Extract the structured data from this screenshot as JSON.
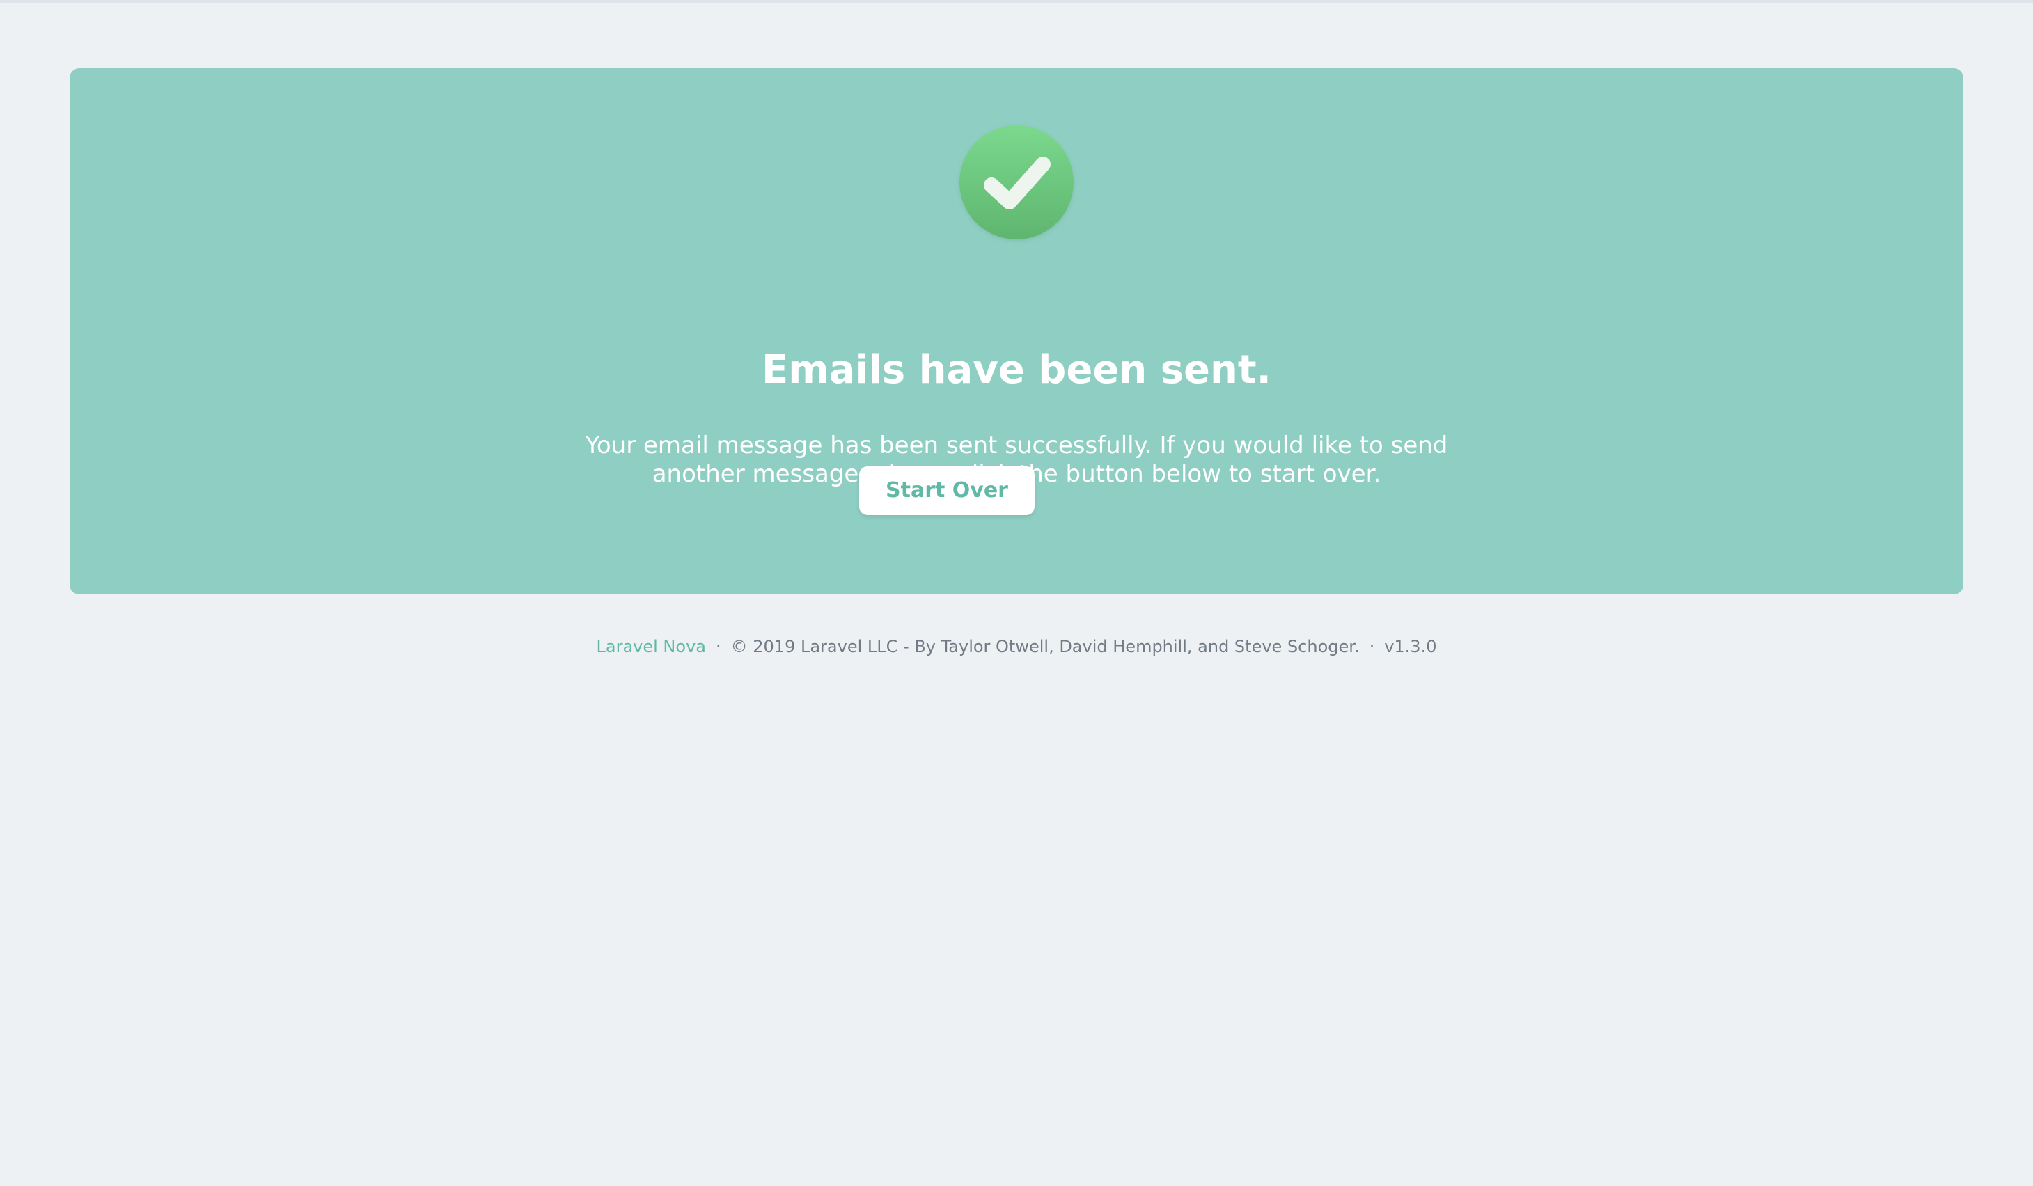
{
  "colors": {
    "page_background": "#eef1f4",
    "card_background": "#8fcfc3",
    "accent": "#5fb9a6",
    "success_badge_top": "#7bd98e",
    "success_badge_bottom": "#5fb56f"
  },
  "success_card": {
    "icon": "checkmark-icon",
    "heading": "Emails have been sent.",
    "message": "Your email message has been sent successfully. If you would like to send another message, please click the button below to start over.",
    "button_label": "Start Over"
  },
  "footer": {
    "brand_link": "Laravel Nova",
    "separator": "·",
    "copyright": "© 2019 Laravel LLC - By Taylor Otwell, David Hemphill, and Steve Schoger.",
    "version": "v1.3.0"
  }
}
